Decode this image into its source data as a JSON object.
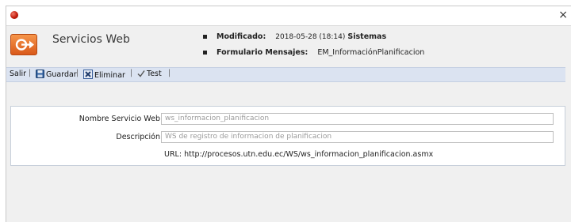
{
  "window": {
    "close_glyph": "×"
  },
  "header": {
    "title": "Servicios Web",
    "modified_label": "Modificado:",
    "modified_value": "2018-05-28 (18:14)",
    "modified_user": "Sistemas",
    "form_label": "Formulario Mensajes:",
    "form_value": "EM_InformaciónPlanificacion"
  },
  "toolbar": {
    "exit_label": "Salir",
    "save_label": "Guardar",
    "delete_label": "Eliminar",
    "test_label": "Test"
  },
  "form": {
    "name_label": "Nombre Servicio Web",
    "name_value": "ws_informacion_planificacion",
    "desc_label": "Descripción",
    "desc_value": "WS de registro de informacion de planificacion",
    "url_text": "URL: http://procesos.utn.edu.ec/WS/ws_informacion_planificacion.asmx"
  },
  "colors": {
    "toolbar_bg": "#dbe3f1",
    "accent_orange": "#e8742e",
    "red_dot": "#c21b0b"
  },
  "icons": [
    "red-dot-icon",
    "arrow-logo-icon",
    "save-icon",
    "delete-icon",
    "check-icon",
    "close-icon"
  ]
}
